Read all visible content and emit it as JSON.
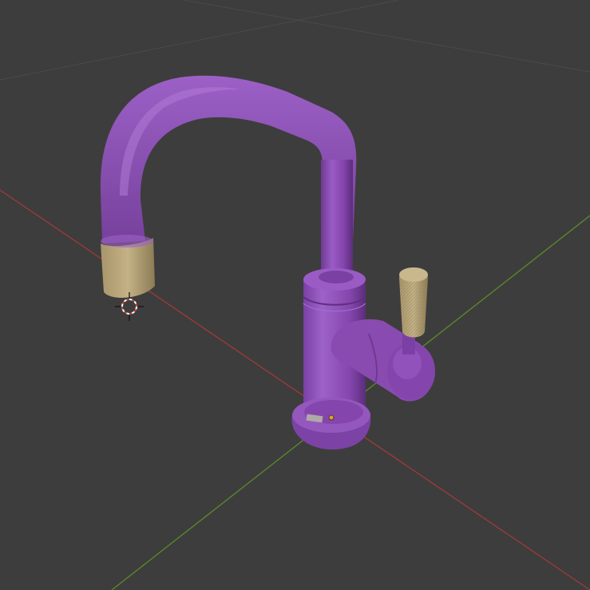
{
  "viewport": {
    "background": "#3d3d3d",
    "grid_color": "#4a4a4a",
    "axis_x_color": "#a23a3a",
    "axis_y_color": "#5e8a2a"
  },
  "model": {
    "body_color": "#8a4bb0",
    "body_highlight": "#a76ad0",
    "body_shadow": "#5e2f7e",
    "accent_color": "#b8a679",
    "accent_shadow": "#8c7c55",
    "origin_dot_color": "#f29a1d"
  },
  "icons": {
    "cursor": "3d-cursor-icon",
    "origin": "object-origin-icon"
  }
}
